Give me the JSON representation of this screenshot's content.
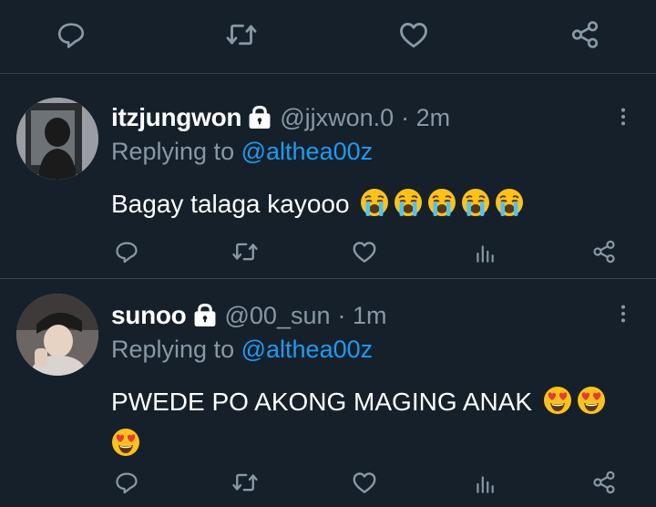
{
  "top_actions": [
    "reply-icon",
    "retweet-icon",
    "like-icon",
    "share-icon"
  ],
  "colors": {
    "background": "#15202b",
    "muted": "#8899a6",
    "accent": "#1d9bf0",
    "divider": "#38444d"
  },
  "replies": [
    {
      "display_name": "itzjungwon",
      "handle": "@jjxwon.0",
      "time": "· 2m",
      "replying_prefix": "Replying to",
      "replying_to": "@althea00z",
      "text": "Bagay talaga kayooo",
      "emojis": [
        "loudly-crying-face",
        "loudly-crying-face",
        "loudly-crying-face",
        "loudly-crying-face",
        "loudly-crying-face"
      ]
    },
    {
      "display_name": "sunoo",
      "handle": "@00_sun",
      "time": "· 1m",
      "replying_prefix": "Replying to",
      "replying_to": "@althea00z",
      "text": "PWEDE PO AKONG MAGING ANAK",
      "emojis": [
        "heart-eyes-face",
        "heart-eyes-face",
        "heart-eyes-face"
      ]
    }
  ]
}
